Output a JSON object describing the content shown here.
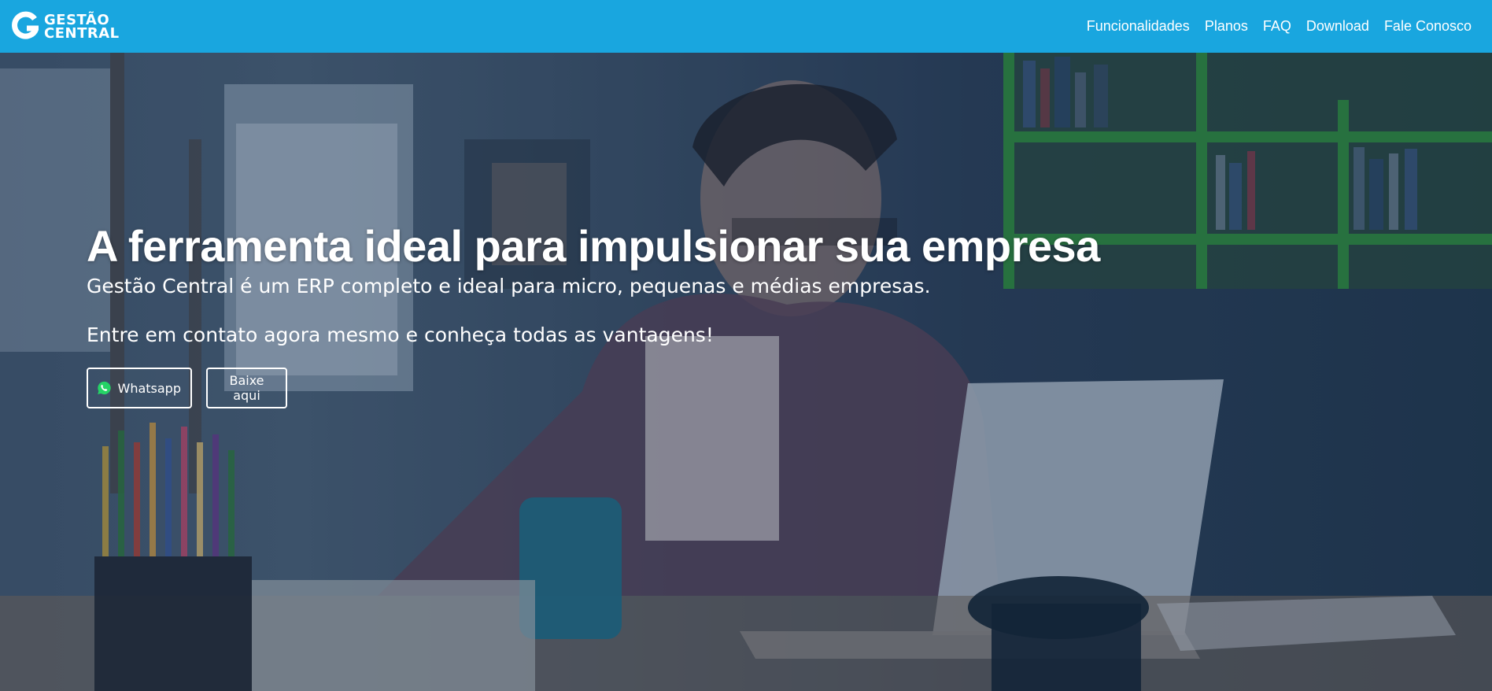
{
  "brand": {
    "line1": "GESTÃO",
    "line2": "CENTRAL",
    "color": "#19a6df"
  },
  "nav": {
    "items": [
      {
        "label": "Funcionalidades"
      },
      {
        "label": "Planos"
      },
      {
        "label": "FAQ"
      },
      {
        "label": "Download"
      },
      {
        "label": "Fale Conosco"
      }
    ]
  },
  "hero": {
    "title": "A ferramenta ideal para impulsionar sua empresa",
    "subtitle": "Gestão Central é um ERP completo e ideal para micro, pequenas e médias empresas.",
    "cta_text": "Entre em contato agora mesmo e conheça todas as vantagens!",
    "buttons": {
      "whatsapp": {
        "label": "Whatsapp",
        "icon": "whatsapp-icon",
        "icon_color": "#25d366"
      },
      "download": {
        "label": "Baixe aqui"
      }
    }
  }
}
